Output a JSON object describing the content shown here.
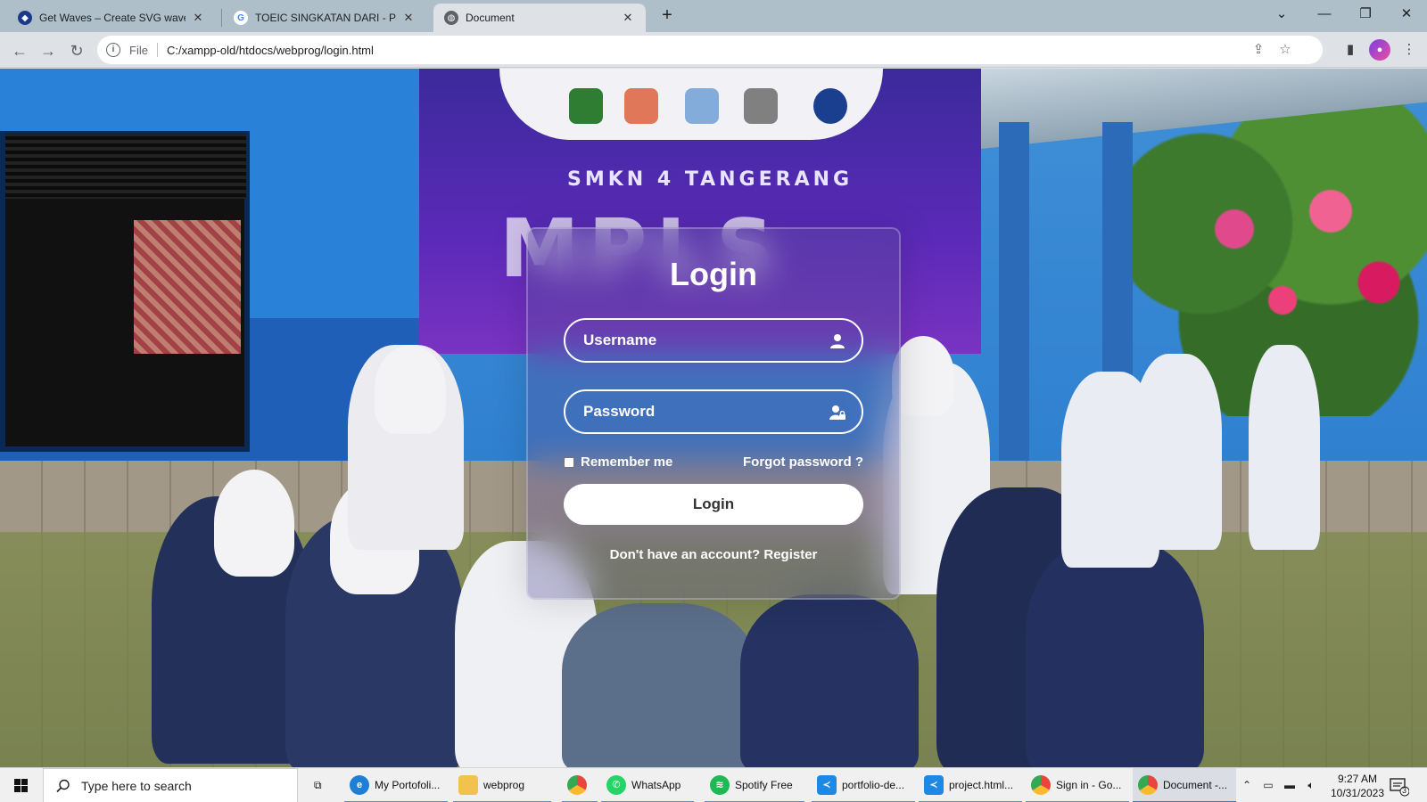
{
  "browser": {
    "tabs": [
      {
        "title": "Get Waves – Create SVG waves f",
        "favicon": "getwaves-icon",
        "active": false
      },
      {
        "title": "TOEIC SINGKATAN DARI - Penel",
        "favicon": "google-icon",
        "active": false
      },
      {
        "title": "Document",
        "favicon": "globe-icon",
        "active": true
      }
    ],
    "new_tab": "+",
    "omnibox": {
      "scheme": "File",
      "url": "C:/xampp-old/htdocs/webprog/login.html"
    }
  },
  "page": {
    "banner": {
      "school": "SMKN 4 TANGERANG"
    },
    "login": {
      "title": "Login",
      "username_placeholder": "Username",
      "password_placeholder": "Password",
      "remember_label": "Remember me",
      "forgot_label": "Forgot password ?",
      "submit_label": "Login",
      "register_text": "Don't have an account? Register"
    }
  },
  "taskbar": {
    "search_placeholder": "Type here to search",
    "apps": [
      {
        "label": "My Portofoli...",
        "icon": "edge-icon",
        "color": "#1f7fd4"
      },
      {
        "label": "webprog",
        "icon": "folder-icon",
        "color": "#f2c14e"
      },
      {
        "label": "",
        "icon": "chrome-icon",
        "color": "#e8453c"
      },
      {
        "label": "WhatsApp",
        "icon": "whatsapp-icon",
        "color": "#25d366"
      },
      {
        "label": "Spotify Free",
        "icon": "spotify-icon",
        "color": "#1db954"
      },
      {
        "label": "portfolio-de...",
        "icon": "vscode-icon",
        "color": "#1e88e5"
      },
      {
        "label": "project.html...",
        "icon": "vscode-icon",
        "color": "#1e88e5"
      },
      {
        "label": "Sign in - Go...",
        "icon": "chrome-icon",
        "color": "#e8453c"
      },
      {
        "label": "Document -...",
        "icon": "chrome-icon",
        "color": "#e8453c"
      }
    ],
    "clock": {
      "time": "9:27 AM",
      "date": "10/31/2023"
    },
    "notifications": "3"
  }
}
